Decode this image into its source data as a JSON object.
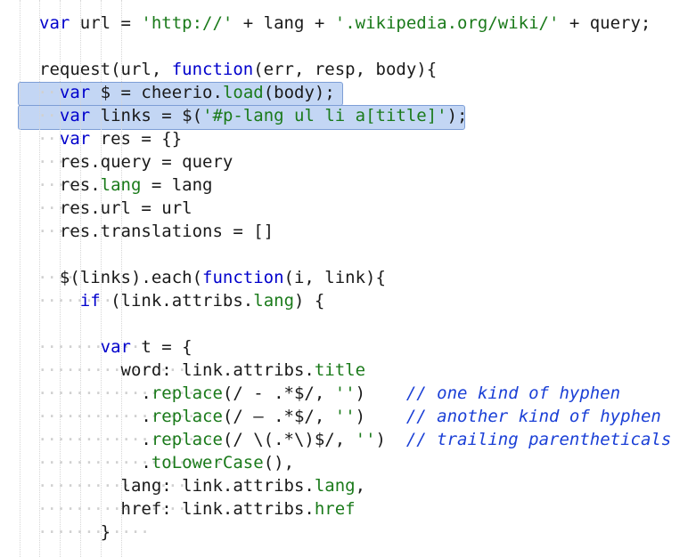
{
  "editor": {
    "language": "javascript",
    "colors": {
      "keyword": "#0000cc",
      "string": "#1a7a1a",
      "comment": "#1a3fd6",
      "selection": "#c3d6f4"
    },
    "lines": [
      [
        {
          "t": "var",
          "c": "kw"
        },
        {
          "t": " url = ",
          "c": ""
        },
        {
          "t": "'http://'",
          "c": "str"
        },
        {
          "t": " + lang + ",
          "c": ""
        },
        {
          "t": "'.wikipedia.org/wiki/'",
          "c": "str"
        },
        {
          "t": " + query;",
          "c": ""
        }
      ],
      [],
      [
        {
          "t": "request(url, ",
          "c": ""
        },
        {
          "t": "function",
          "c": "kw"
        },
        {
          "t": "(err, resp, body){",
          "c": ""
        }
      ],
      [
        {
          "t": "  ",
          "c": ""
        },
        {
          "t": "var",
          "c": "kw"
        },
        {
          "t": " $ = cheerio.",
          "c": ""
        },
        {
          "t": "load",
          "c": "prop"
        },
        {
          "t": "(body);",
          "c": ""
        }
      ],
      [
        {
          "t": "  ",
          "c": ""
        },
        {
          "t": "var",
          "c": "kw"
        },
        {
          "t": " links = $(",
          "c": ""
        },
        {
          "t": "'#p-lang ul li a[title]'",
          "c": "str"
        },
        {
          "t": ");",
          "c": ""
        }
      ],
      [
        {
          "t": "  ",
          "c": ""
        },
        {
          "t": "var",
          "c": "kw"
        },
        {
          "t": " res = {}",
          "c": ""
        }
      ],
      [
        {
          "t": "  res.query = query",
          "c": ""
        }
      ],
      [
        {
          "t": "  res.",
          "c": ""
        },
        {
          "t": "lang",
          "c": "prop"
        },
        {
          "t": " = lang",
          "c": ""
        }
      ],
      [
        {
          "t": "  res.url = url",
          "c": ""
        }
      ],
      [
        {
          "t": "  res.translations = []",
          "c": ""
        }
      ],
      [],
      [
        {
          "t": "  $(links).each(",
          "c": ""
        },
        {
          "t": "function",
          "c": "kw"
        },
        {
          "t": "(i, link){",
          "c": ""
        }
      ],
      [
        {
          "t": "    ",
          "c": ""
        },
        {
          "t": "if",
          "c": "kw"
        },
        {
          "t": " (link.attribs.",
          "c": ""
        },
        {
          "t": "lang",
          "c": "prop"
        },
        {
          "t": ") {",
          "c": ""
        }
      ],
      [],
      [
        {
          "t": "      ",
          "c": ""
        },
        {
          "t": "var",
          "c": "kw"
        },
        {
          "t": " t = {",
          "c": ""
        }
      ],
      [
        {
          "t": "        word: link.attribs.",
          "c": ""
        },
        {
          "t": "title",
          "c": "prop"
        }
      ],
      [
        {
          "t": "          .",
          "c": ""
        },
        {
          "t": "replace",
          "c": "prop"
        },
        {
          "t": "(/ - .*$/, ",
          "c": ""
        },
        {
          "t": "''",
          "c": "str"
        },
        {
          "t": ")    ",
          "c": ""
        },
        {
          "t": "// one kind of hyphen",
          "c": "cm"
        }
      ],
      [
        {
          "t": "          .",
          "c": ""
        },
        {
          "t": "replace",
          "c": "prop"
        },
        {
          "t": "(/ – .*$/, ",
          "c": ""
        },
        {
          "t": "''",
          "c": "str"
        },
        {
          "t": ")    ",
          "c": ""
        },
        {
          "t": "// another kind of hyphen",
          "c": "cm"
        }
      ],
      [
        {
          "t": "          .",
          "c": ""
        },
        {
          "t": "replace",
          "c": "prop"
        },
        {
          "t": "(/ \\(.*\\)$/, ",
          "c": ""
        },
        {
          "t": "''",
          "c": "str"
        },
        {
          "t": ")  ",
          "c": ""
        },
        {
          "t": "// trailing parentheticals",
          "c": "cm"
        }
      ],
      [
        {
          "t": "          .",
          "c": ""
        },
        {
          "t": "toLowerCase",
          "c": "prop"
        },
        {
          "t": "(),",
          "c": ""
        }
      ],
      [
        {
          "t": "        lang: link.attribs.",
          "c": ""
        },
        {
          "t": "lang",
          "c": "prop"
        },
        {
          "t": ",",
          "c": ""
        }
      ],
      [
        {
          "t": "        href: link.attribs.",
          "c": ""
        },
        {
          "t": "href",
          "c": "prop"
        }
      ],
      [
        {
          "t": "      }",
          "c": ""
        }
      ]
    ]
  }
}
